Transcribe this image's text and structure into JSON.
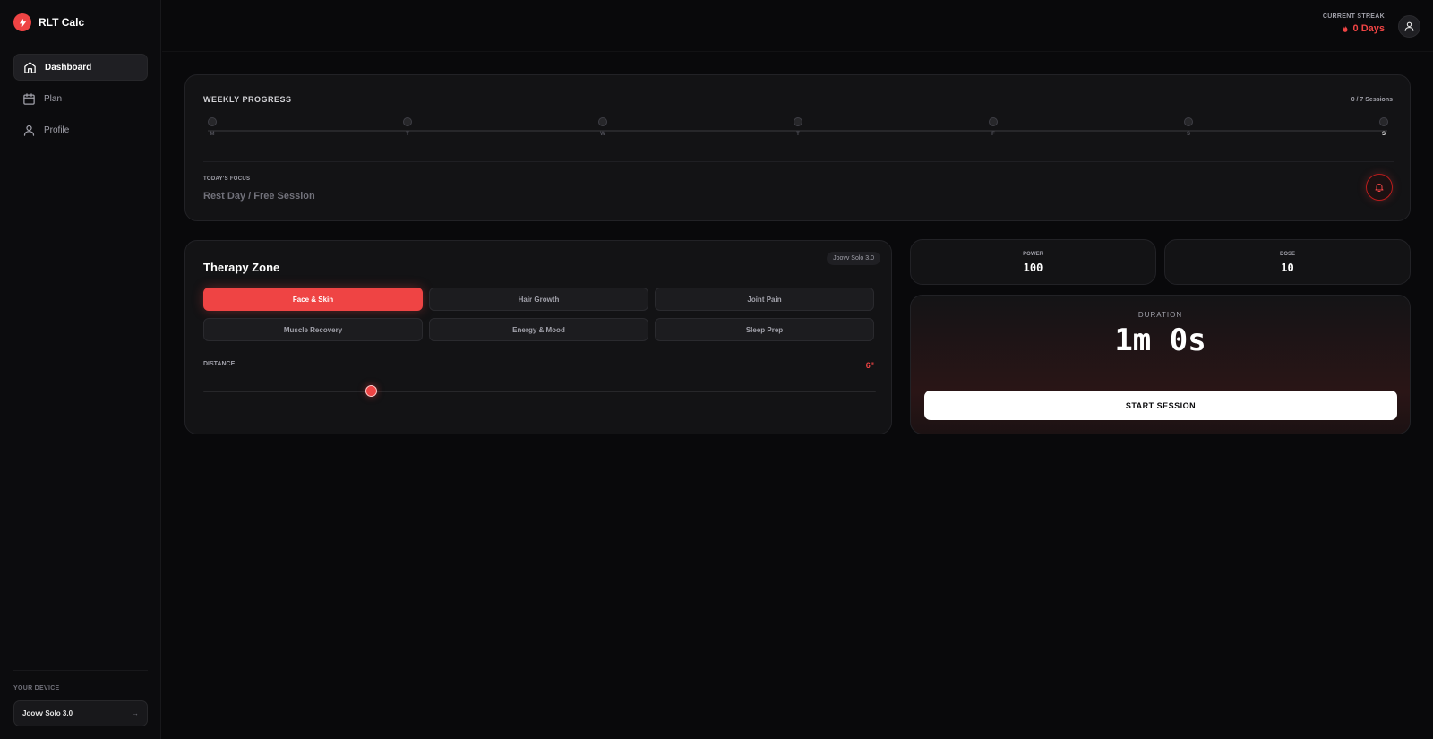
{
  "app": {
    "name": "RLT Calc"
  },
  "sidebar": {
    "items": [
      {
        "label": "Dashboard",
        "active": true,
        "icon": "home-icon"
      },
      {
        "label": "Plan",
        "active": false,
        "icon": "calendar-icon"
      },
      {
        "label": "Profile",
        "active": false,
        "icon": "user-icon"
      }
    ],
    "device_label": "YOUR DEVICE",
    "device_name": "Joovv Solo 3.0",
    "device_arrow": "→"
  },
  "header": {
    "streak_label": "CURRENT STREAK",
    "streak_value": "0 Days"
  },
  "weekly": {
    "title": "WEEKLY PROGRESS",
    "count": "0 / 7 Sessions",
    "days": [
      "M",
      "T",
      "W",
      "T",
      "F",
      "S",
      "S"
    ],
    "current_day_index": 6,
    "focus_label": "TODAY'S FOCUS",
    "focus_value": "Rest Day / Free Session"
  },
  "zone": {
    "title": "Therapy Zone",
    "device_chip": "Joovv Solo 3.0",
    "options": [
      {
        "label": "Face & Skin",
        "active": true
      },
      {
        "label": "Hair Growth",
        "active": false
      },
      {
        "label": "Joint Pain",
        "active": false
      },
      {
        "label": "Muscle Recovery",
        "active": false
      },
      {
        "label": "Energy & Mood",
        "active": false
      },
      {
        "label": "Sleep Prep",
        "active": false
      }
    ],
    "distance_label": "DISTANCE",
    "distance_value": "6\"",
    "distance_fraction": 0.25
  },
  "stats": {
    "power_label": "POWER",
    "power_value": "100",
    "dose_label": "DOSE",
    "dose_value": "10"
  },
  "session": {
    "duration_label": "DURATION",
    "duration_value": "1m 0s",
    "start_label": "START SESSION"
  },
  "colors": {
    "accent": "#ef4444",
    "background": "#09090b",
    "card": "#131315"
  }
}
